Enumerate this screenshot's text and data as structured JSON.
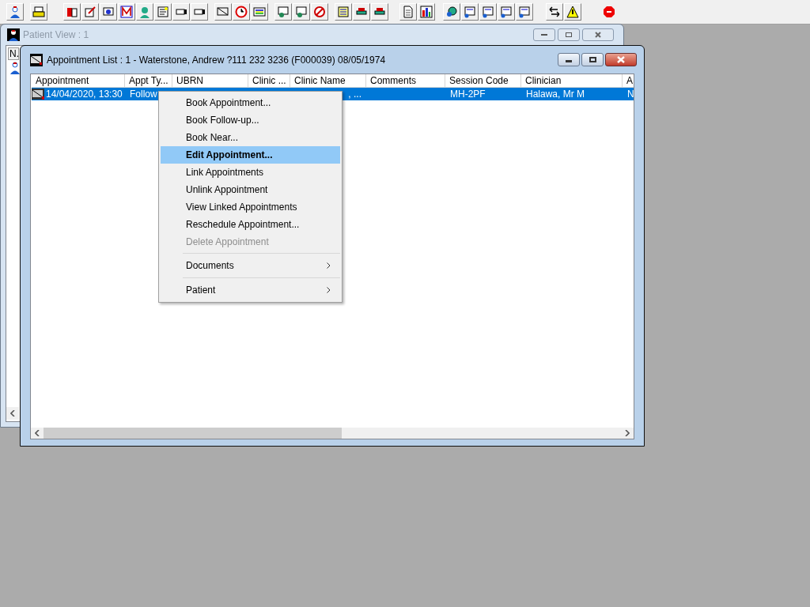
{
  "patient_window": {
    "title": "Patient View : 1",
    "list_header": "N.",
    "active": false
  },
  "appointment_window": {
    "title": "Appointment List : 1 - Waterstone, Andrew ?111 232 3236 (F000039) 08/05/1974",
    "active": true
  },
  "table": {
    "columns": [
      "Appointment",
      "Appt Ty...",
      "UBRN",
      "Clinic ...",
      "Clinic Name",
      "Comments",
      "Session Code",
      "Clinician",
      "A"
    ],
    "rows": [
      {
        "selected": true,
        "cells": [
          "14/04/2020, 13:30",
          "Follow",
          "",
          "",
          ", ...",
          "",
          "MH-2PF",
          "Halawa, Mr M",
          "N"
        ]
      }
    ]
  },
  "context_menu": {
    "items": [
      {
        "kind": "item",
        "label": "Book Appointment...",
        "selected": false,
        "disabled": false
      },
      {
        "kind": "item",
        "label": "Book Follow-up...",
        "selected": false,
        "disabled": false
      },
      {
        "kind": "item",
        "label": "Book Near...",
        "selected": false,
        "disabled": false
      },
      {
        "kind": "item",
        "label": "Edit Appointment...",
        "selected": true,
        "disabled": false
      },
      {
        "kind": "item",
        "label": "Link Appointments",
        "selected": false,
        "disabled": false
      },
      {
        "kind": "item",
        "label": "Unlink Appointment",
        "selected": false,
        "disabled": false
      },
      {
        "kind": "item",
        "label": "View Linked Appointments",
        "selected": false,
        "disabled": false
      },
      {
        "kind": "item",
        "label": "Reschedule Appointment...",
        "selected": false,
        "disabled": false
      },
      {
        "kind": "item",
        "label": "Delete Appointment",
        "selected": false,
        "disabled": true
      },
      {
        "kind": "separator"
      },
      {
        "kind": "submenu",
        "label": "Documents",
        "selected": false,
        "disabled": false
      },
      {
        "kind": "separator"
      },
      {
        "kind": "submenu",
        "label": "Patient",
        "selected": false,
        "disabled": false
      }
    ]
  }
}
